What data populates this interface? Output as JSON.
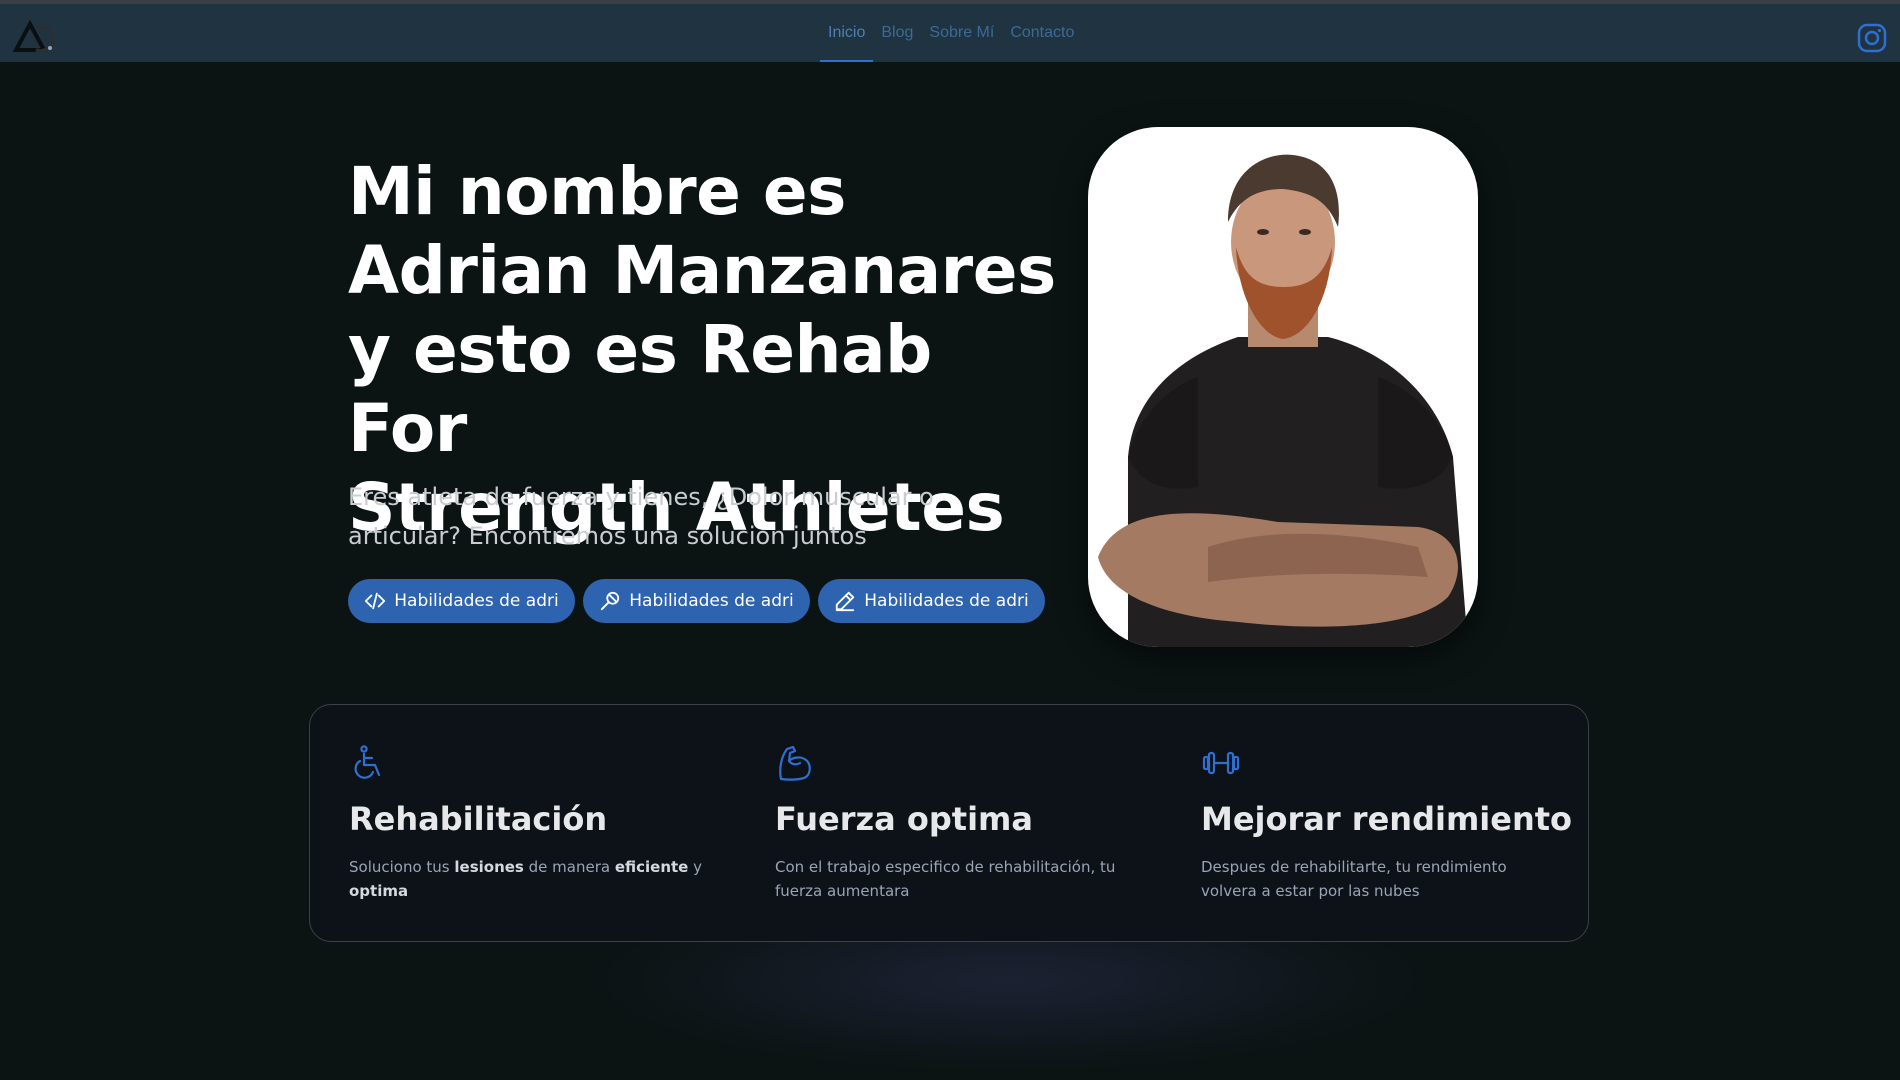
{
  "nav": {
    "links": [
      "Inicio",
      "Blog",
      "Sobre Mí",
      "Contacto"
    ],
    "active": "Inicio",
    "accent": "#2f6fd0"
  },
  "hero": {
    "title_lines": [
      "Mi nombre es",
      "Adrian Manzanares",
      "y esto es Rehab For",
      "Strength Athletes"
    ],
    "subtitle": "Eres atleta de fuerza y tienes, ¿Dolor muscular o articular? Encontremos una solucion juntos",
    "buttons": [
      {
        "label": "Habilidades de adri",
        "icon": "code-icon"
      },
      {
        "label": "Habilidades de adri",
        "icon": "microphone-icon"
      },
      {
        "label": "Habilidades de adri",
        "icon": "pencil-icon"
      }
    ],
    "button_color": "#2e63b0"
  },
  "features": [
    {
      "icon": "wheelchair-icon",
      "title": "Rehabilitación",
      "text_parts": [
        "Soluciono tus ",
        "lesiones",
        " de manera ",
        "eficiente",
        " y ",
        "optima"
      ]
    },
    {
      "icon": "flexed-bicep-icon",
      "title": "Fuerza optima",
      "text": "Con el trabajo especifico de rehabilitación, tu fuerza aumentara"
    },
    {
      "icon": "dumbbell-icon",
      "title": "Mejorar rendimiento",
      "text": "Despues de rehabilitarte, tu rendimiento volvera a estar por las nubes"
    }
  ],
  "social": {
    "icon": "instagram-icon"
  }
}
